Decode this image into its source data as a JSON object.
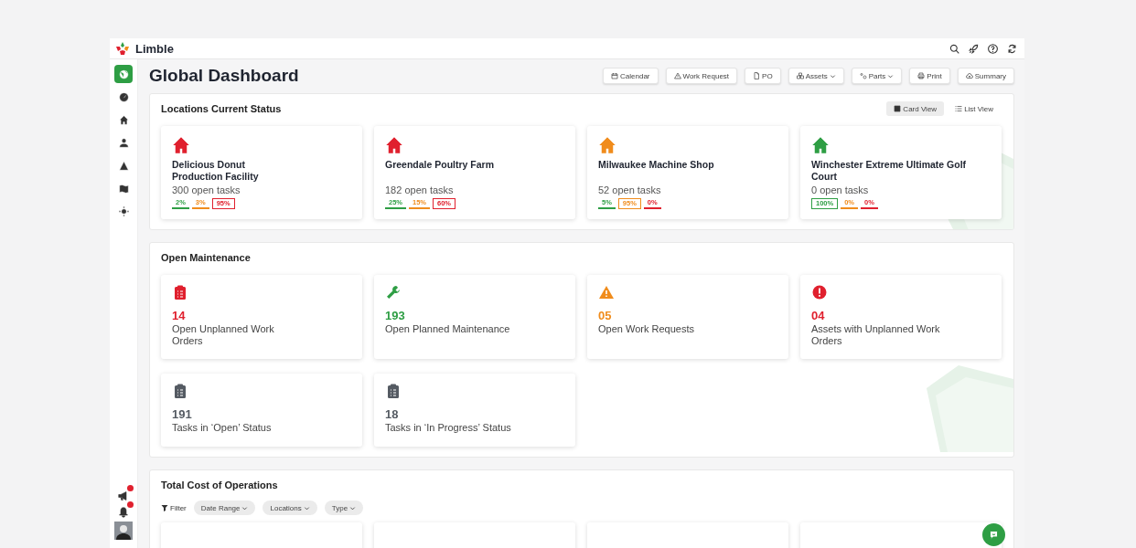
{
  "brand": {
    "name": "Limble"
  },
  "sidebar": {
    "items": [
      {
        "selected": true
      },
      {
        "selected": false
      },
      {
        "selected": false
      },
      {
        "selected": false
      },
      {
        "selected": false
      },
      {
        "selected": false
      },
      {
        "selected": false
      }
    ]
  },
  "page_title": "Global Dashboard",
  "toolbar": [
    {
      "label": "Calendar",
      "kind": "plain"
    },
    {
      "label": "Work Request",
      "kind": "plain"
    },
    {
      "label": "PO",
      "kind": "plain"
    },
    {
      "label": "Assets",
      "kind": "dropdown"
    },
    {
      "label": "Parts",
      "kind": "dropdown"
    },
    {
      "label": "Print",
      "kind": "plain"
    },
    {
      "label": "Summary",
      "kind": "plain"
    }
  ],
  "locations": {
    "title": "Locations Current Status",
    "views": [
      {
        "label": "Card View",
        "selected": true
      },
      {
        "label": "List View",
        "selected": false
      }
    ],
    "cards": [
      {
        "name": "Delicious Donut Production Facility",
        "color": "#e0202e",
        "tasks": "300 open tasks",
        "stats": [
          {
            "label": "2%",
            "color": "#2e9e44",
            "boxed": false
          },
          {
            "label": "3%",
            "color": "#f08c1c",
            "boxed": false
          },
          {
            "label": "95%",
            "color": "#e0202e",
            "boxed": true
          }
        ]
      },
      {
        "name": "Greendale Poultry Farm",
        "color": "#e0202e",
        "tasks": "182 open tasks",
        "stats": [
          {
            "label": "25%",
            "color": "#2e9e44",
            "boxed": false
          },
          {
            "label": "15%",
            "color": "#f08c1c",
            "boxed": false
          },
          {
            "label": "60%",
            "color": "#e0202e",
            "boxed": true
          }
        ]
      },
      {
        "name": "Milwaukee Machine Shop",
        "color": "#f08c1c",
        "tasks": "52 open tasks",
        "stats": [
          {
            "label": "5%",
            "color": "#2e9e44",
            "boxed": false
          },
          {
            "label": "95%",
            "color": "#f08c1c",
            "boxed": true
          },
          {
            "label": "0%",
            "color": "#e0202e",
            "boxed": false
          }
        ]
      },
      {
        "name": "Winchester Extreme Ultimate Golf Court",
        "color": "#2e9e44",
        "tasks": "0 open tasks",
        "stats": [
          {
            "label": "100%",
            "color": "#2e9e44",
            "boxed": true
          },
          {
            "label": "0%",
            "color": "#f08c1c",
            "boxed": false
          },
          {
            "label": "0%",
            "color": "#e0202e",
            "boxed": false
          }
        ]
      }
    ]
  },
  "maintenance": {
    "title": "Open Maintenance",
    "cards": [
      {
        "kind": "clipboard",
        "value": "14",
        "label": "Open Unplanned Work Orders",
        "color": "#e0202e"
      },
      {
        "kind": "wrench",
        "value": "193",
        "label": "Open Planned Maintenance",
        "color": "#2e9e44"
      },
      {
        "kind": "warning",
        "value": "05",
        "label": "Open Work Requests",
        "color": "#f08c1c"
      },
      {
        "kind": "alert",
        "value": "04",
        "label": "Assets with Unplanned Work Orders",
        "color": "#e0202e"
      },
      {
        "kind": "clipboard",
        "value": "191",
        "label": "Tasks in ‘Open’ Status",
        "color": "#555b63"
      },
      {
        "kind": "clipboard",
        "value": "18",
        "label": "Tasks in ‘In Progress’ Status",
        "color": "#555b63"
      }
    ]
  },
  "cost": {
    "title": "Total Cost of Operations",
    "filter_label": "Filter",
    "filters": [
      "Date Range",
      "Locations",
      "Type"
    ]
  }
}
